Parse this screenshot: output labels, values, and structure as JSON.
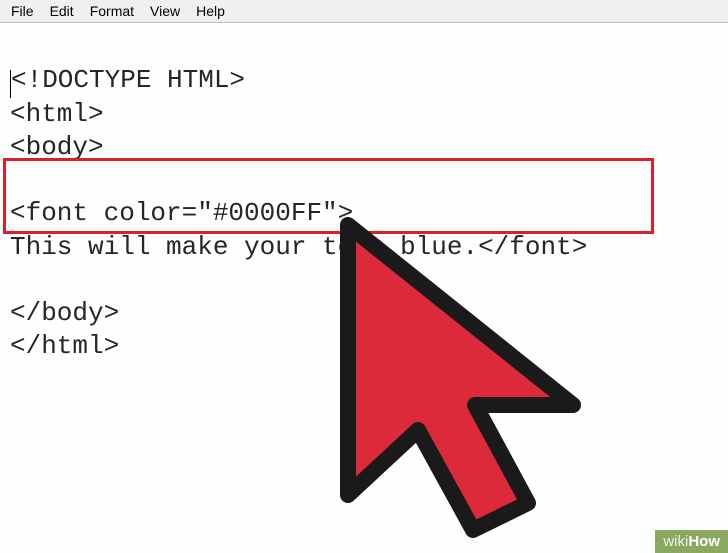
{
  "menubar": {
    "items": [
      "File",
      "Edit",
      "Format",
      "View",
      "Help"
    ]
  },
  "editor": {
    "lines": [
      "<!DOCTYPE HTML>",
      "<html>",
      "<body>",
      "",
      "<font color=\"#0000FF\">",
      "This will make your text blue.</font>",
      "",
      "</body>",
      "</html>"
    ]
  },
  "watermark": {
    "prefix": "wiki",
    "suffix": "How"
  },
  "annotation": {
    "highlight_color": "#db1f2b",
    "cursor_fill": "#dc2a3a",
    "cursor_stroke": "#1a1a1a"
  }
}
